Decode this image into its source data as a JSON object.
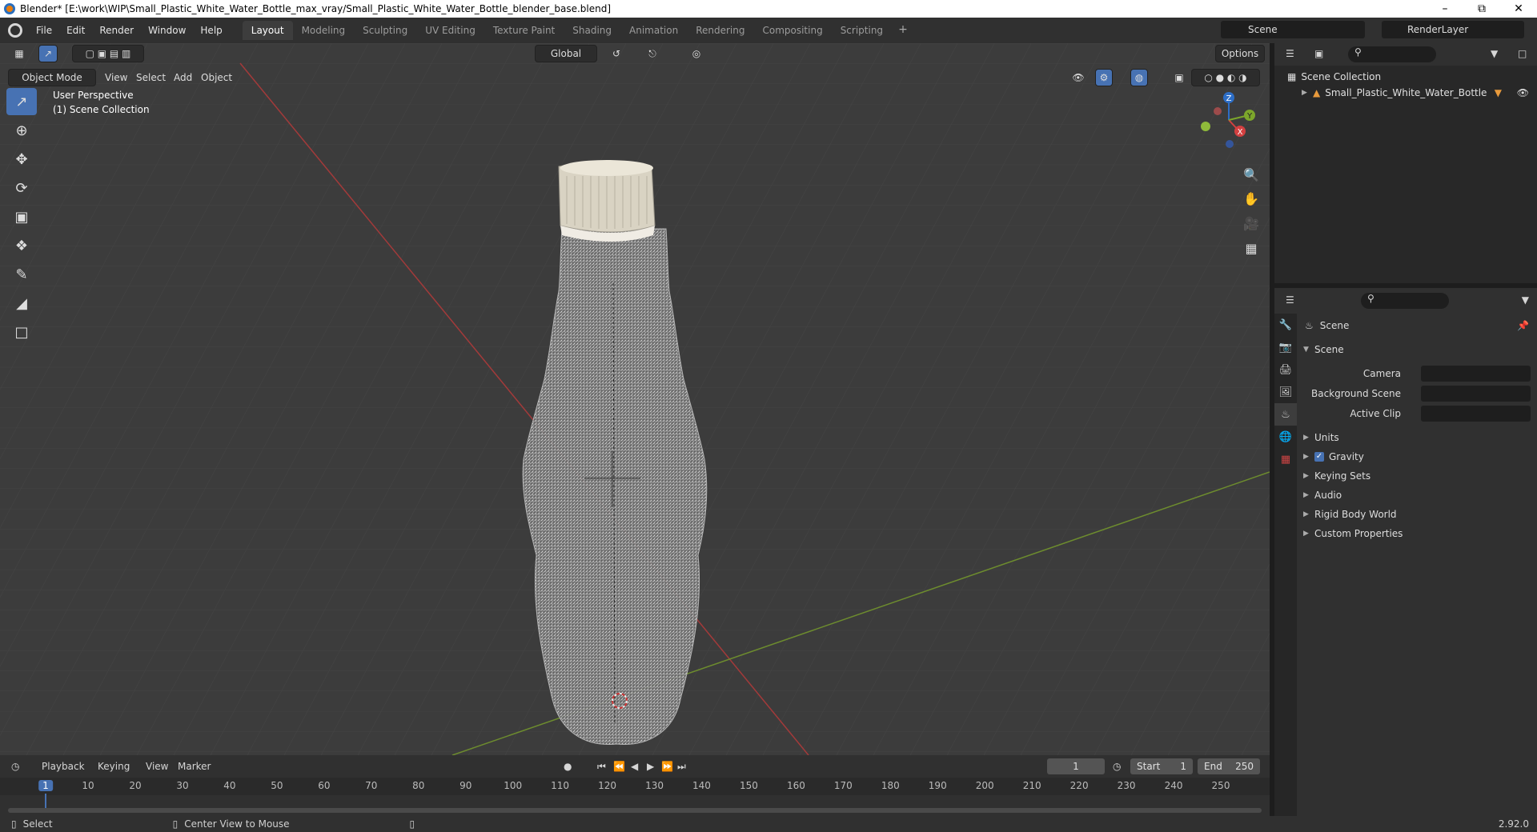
{
  "window": {
    "title": "Blender* [E:\\work\\WIP\\Small_Plastic_White_Water_Bottle_max_vray/Small_Plastic_White_Water_Bottle_blender_base.blend]"
  },
  "menu": [
    "File",
    "Edit",
    "Render",
    "Window",
    "Help"
  ],
  "tabs": [
    "Layout",
    "Modeling",
    "Sculpting",
    "UV Editing",
    "Texture Paint",
    "Shading",
    "Animation",
    "Rendering",
    "Compositing",
    "Scripting"
  ],
  "scene_name": "Scene",
  "render_layer": "RenderLayer",
  "viewport": {
    "mode": "Object Mode",
    "menus": [
      "View",
      "Select",
      "Add",
      "Object"
    ],
    "transform": "Global",
    "options": "Options",
    "overlay_line1": "User Perspective",
    "overlay_line2": "(1) Scene Collection",
    "axes": {
      "x": "X",
      "y": "Y",
      "z": "Z"
    }
  },
  "outliner": {
    "collection": "Scene Collection",
    "object": "Small_Plastic_White_Water_Bottle"
  },
  "properties": {
    "header": "Scene",
    "panel": "Scene",
    "fields": [
      {
        "label": "Camera"
      },
      {
        "label": "Background Scene"
      },
      {
        "label": "Active Clip"
      }
    ],
    "sections": [
      "Units",
      "Gravity",
      "Keying Sets",
      "Audio",
      "Rigid Body World",
      "Custom Properties"
    ],
    "gravity_checked": true
  },
  "timeline": {
    "menus": [
      "Playback",
      "Keying",
      "View",
      "Marker"
    ],
    "current_frame": "1",
    "start_label": "Start",
    "start": "1",
    "end_label": "End",
    "end": "250",
    "ticks": [
      "1",
      "10",
      "20",
      "30",
      "40",
      "50",
      "60",
      "70",
      "80",
      "90",
      "100",
      "110",
      "120",
      "130",
      "140",
      "150",
      "160",
      "170",
      "180",
      "190",
      "200",
      "210",
      "220",
      "230",
      "240",
      "250"
    ]
  },
  "status": {
    "left": "Select",
    "mid": "Center View to Mouse",
    "version": "2.92.0"
  }
}
